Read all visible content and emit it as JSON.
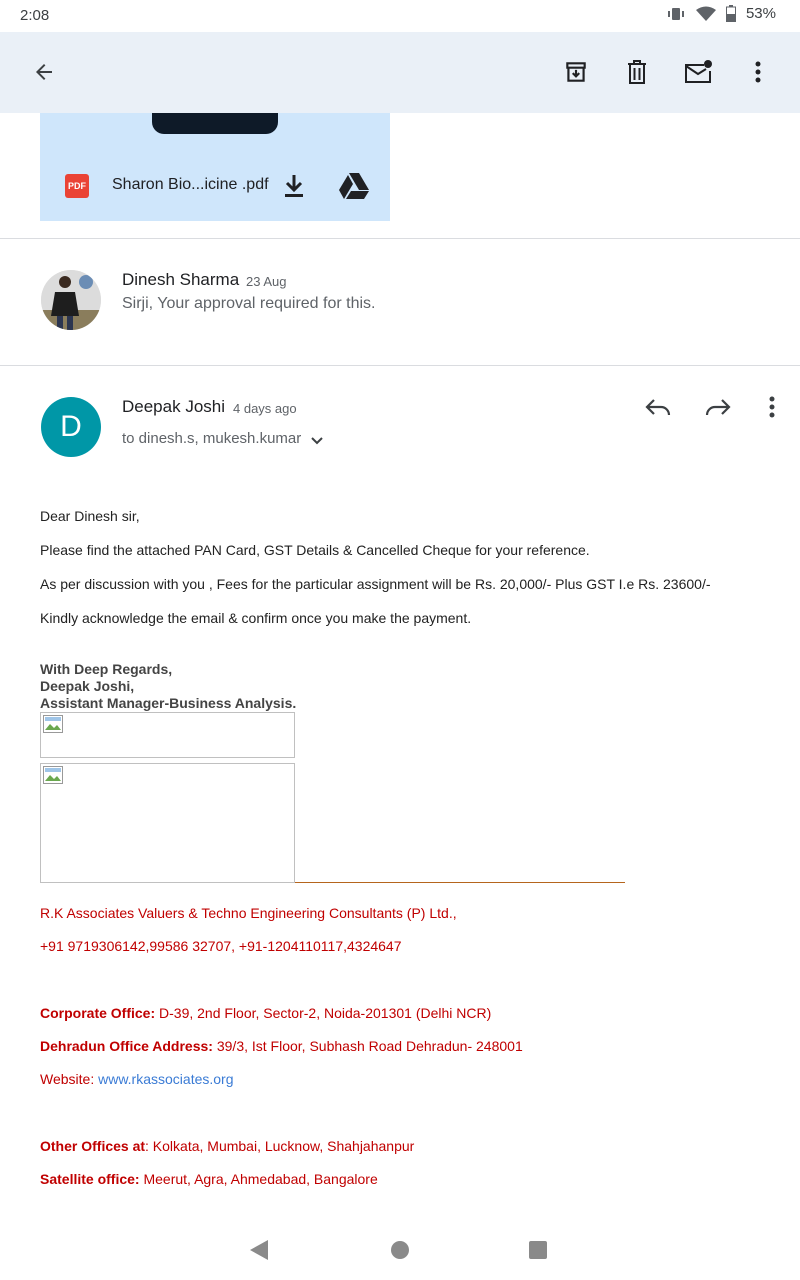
{
  "status": {
    "time": "2:08",
    "battery": "53%"
  },
  "attachment": {
    "type_label": "PDF",
    "file_name": "Sharon Bio...icine .pdf"
  },
  "messages": [
    {
      "sender": "Dinesh Sharma",
      "date": "23 Aug",
      "snippet": "Sirji, Your approval required for this."
    },
    {
      "sender": "Deepak Joshi",
      "avatar_letter": "D",
      "date": "4 days ago",
      "recipients": "to dinesh.s, mukesh.kumar"
    }
  ],
  "body": {
    "greeting": "Dear Dinesh sir,",
    "p1": "Please find the attached PAN Card, GST Details & Cancelled Cheque for your reference.",
    "p2": "As per discussion with you , Fees for the particular assignment will be Rs. 20,000/- Plus GST I.e Rs. 23600/-",
    "p3": "Kindly acknowledge the email & confirm once you make the payment.",
    "sig1": "With Deep Regards,",
    "sig2": "Deepak Joshi,",
    "sig3": "Assistant Manager-Business Analysis."
  },
  "footer": {
    "company": "R.K Associates Valuers & Techno Engineering Consultants (P) Ltd.,",
    "phones": "+91 9719306142,99586 32707, +91-1204110117,4324647",
    "corp_label": "Corporate Office:",
    "corp_value": " D-39, 2nd Floor, Sector-2, Noida-201301 (Delhi NCR)",
    "dehradun_label": "Dehradun Office Address:",
    "dehradun_value": " 39/3, Ist Floor, Subhash Road Dehradun- 248001",
    "website_label": "Website: ",
    "website_url": "www.rkassociates.org",
    "other_label": "Other Offices at",
    "other_value": ": Kolkata, Mumbai, Lucknow, Shahjahanpur",
    "satellite_label": "Satellite office:",
    "satellite_value": " Meerut, Agra, Ahmedabad, Bangalore"
  },
  "colors": {
    "app_bar": "#eaf0f7",
    "attachment_bg": "#cfe6fb",
    "avatar": "#0097a7",
    "signature_red": "#c00000",
    "link": "#3a7bd5"
  }
}
